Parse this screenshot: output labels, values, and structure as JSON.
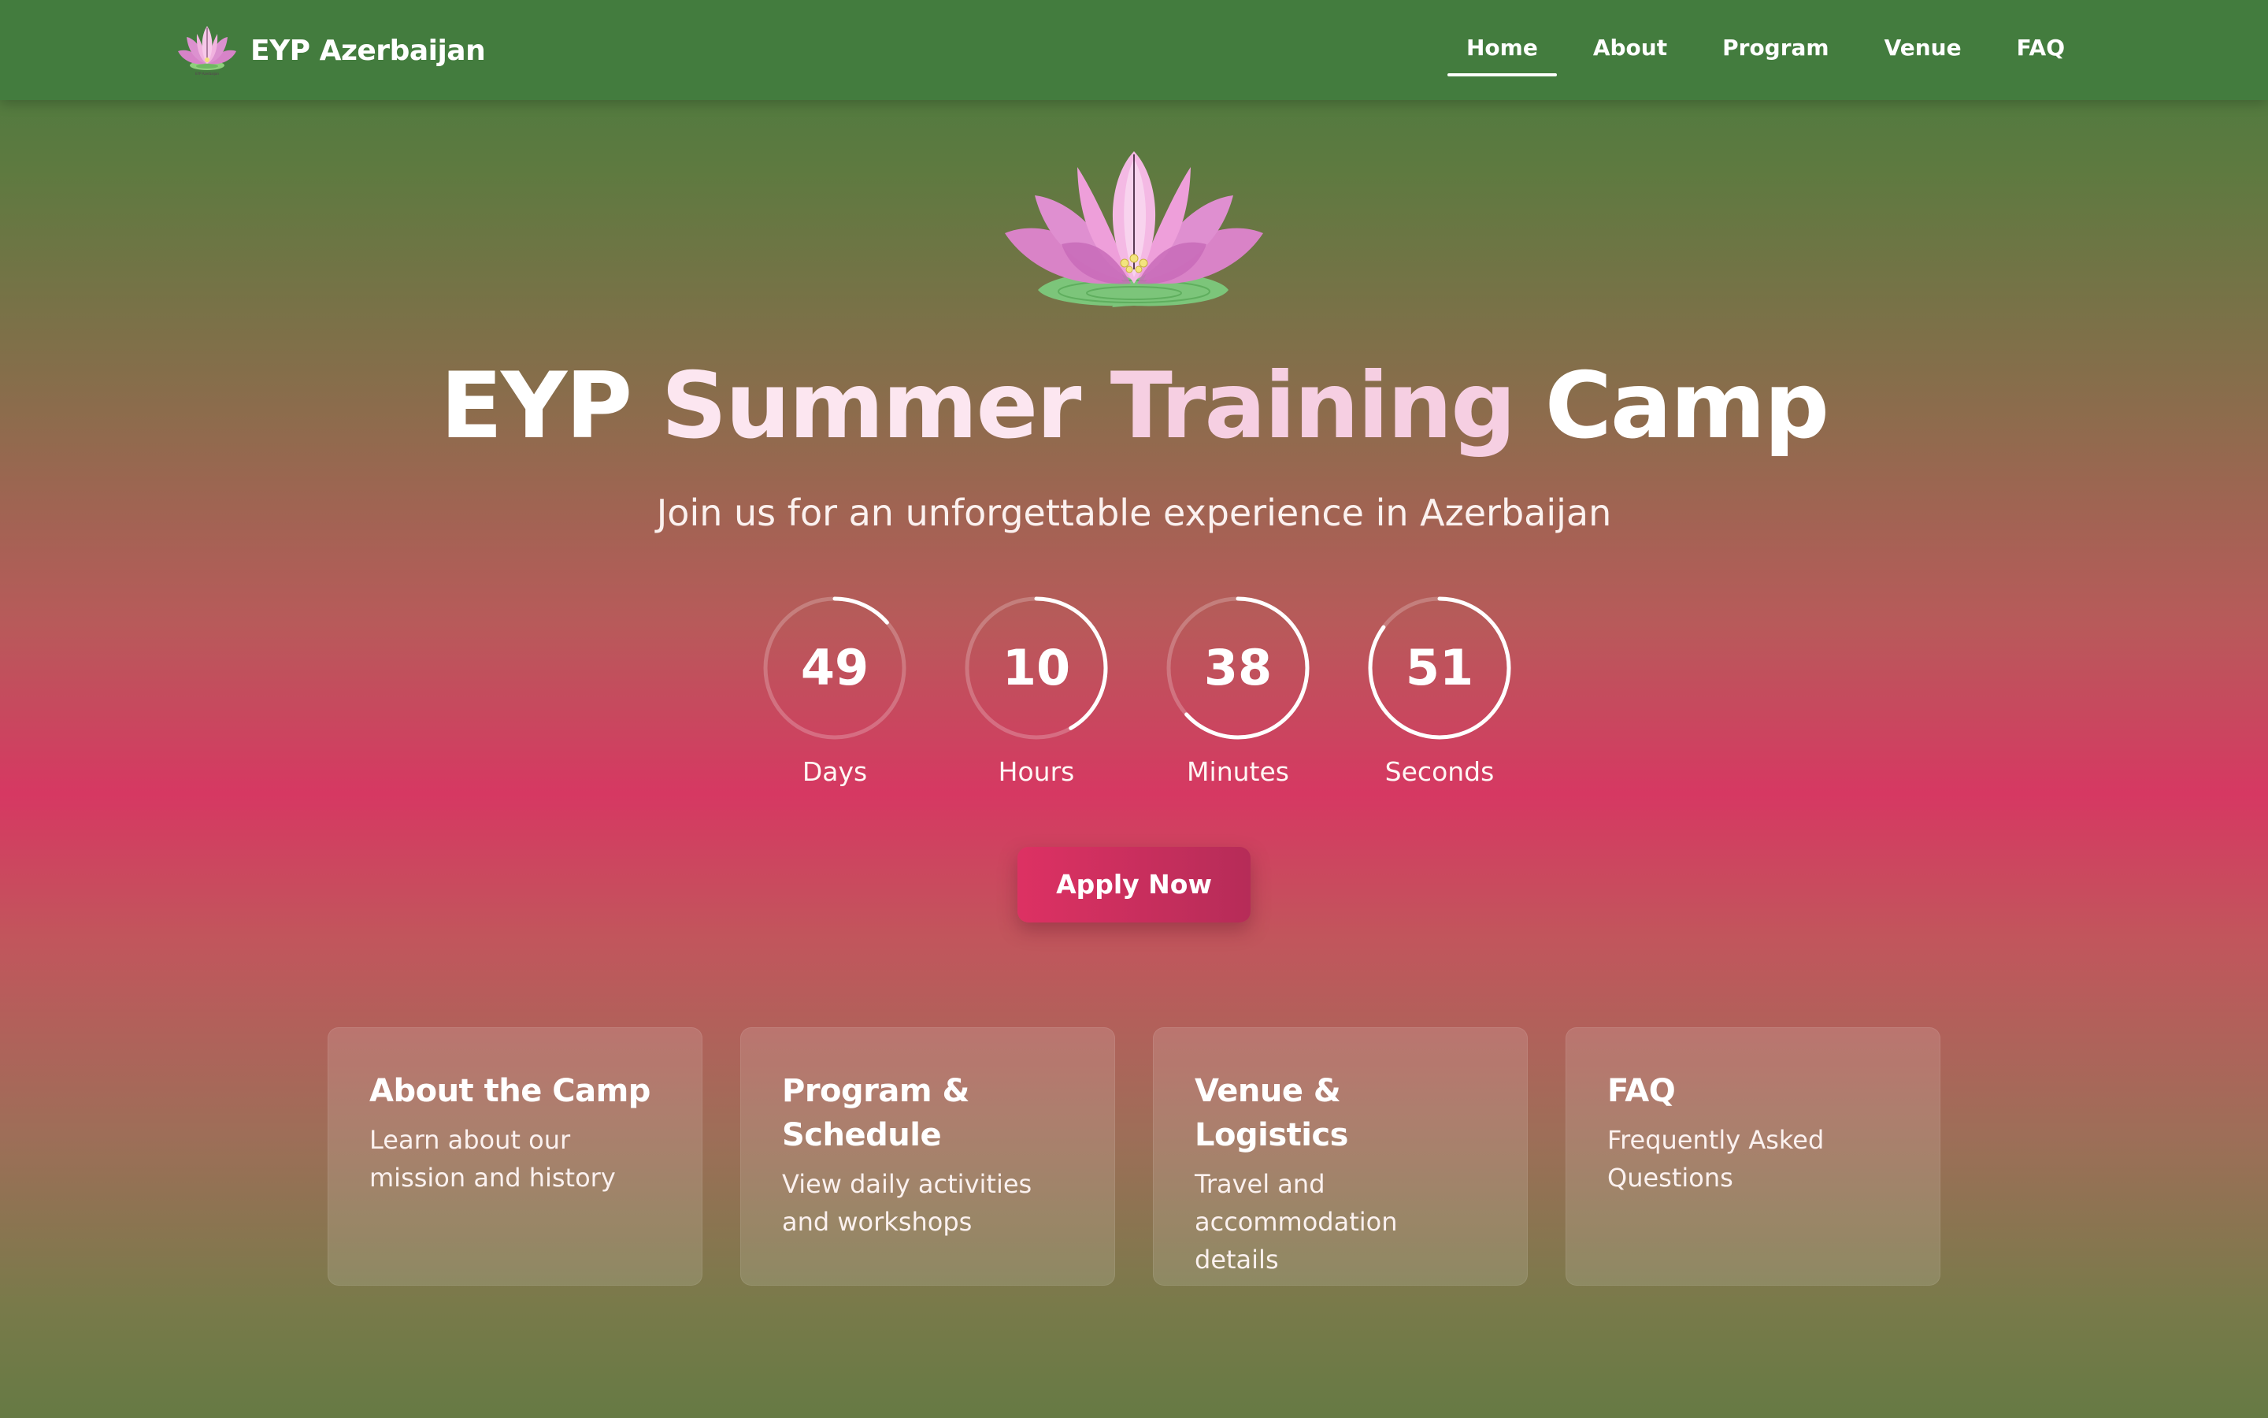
{
  "header": {
    "brand_name": "EYP Azerbaijan",
    "nav": [
      {
        "label": "Home",
        "active": true
      },
      {
        "label": "About",
        "active": false
      },
      {
        "label": "Program",
        "active": false
      },
      {
        "label": "Venue",
        "active": false
      },
      {
        "label": "FAQ",
        "active": false
      }
    ]
  },
  "hero": {
    "logo_icon": "lotus-flower",
    "title_words": [
      "EYP",
      "Summer",
      "Training",
      "Camp"
    ],
    "subtitle": "Join us for an unforgettable experience in Azerbaijan"
  },
  "countdown": [
    {
      "value": "49",
      "label": "Days",
      "progress": 0.136
    },
    {
      "value": "10",
      "label": "Hours",
      "progress": 0.417
    },
    {
      "value": "38",
      "label": "Minutes",
      "progress": 0.633
    },
    {
      "value": "51",
      "label": "Seconds",
      "progress": 0.85
    }
  ],
  "cta": {
    "label": "Apply Now"
  },
  "cards": [
    {
      "title": "About the Camp",
      "description": "Learn about our mission and history"
    },
    {
      "title": "Program & Schedule",
      "description": "View daily activities and workshops"
    },
    {
      "title": "Venue & Logistics",
      "description": "Travel and accommodation details"
    },
    {
      "title": "FAQ",
      "description": "Frequently Asked Questions"
    }
  ],
  "colors": {
    "header_green": "#437c3e",
    "accent_pink": "#d63862",
    "button_start": "#dd3163",
    "button_end": "#b62c58"
  }
}
